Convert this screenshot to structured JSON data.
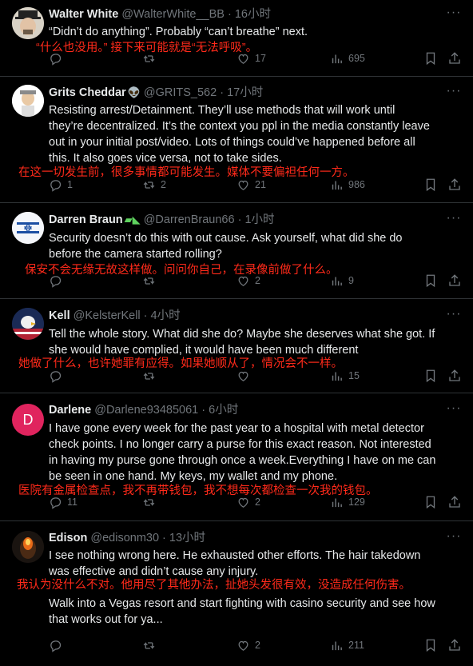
{
  "colors": {
    "background": "#000000",
    "text": "#e7e9ea",
    "muted": "#71767b",
    "translation": "#ff2a1a",
    "divider": "#2f3336"
  },
  "tweets": [
    {
      "name": "Walter White",
      "handle": "@WalterWhite__BB",
      "time": "16小时",
      "lines": [
        "“Didn’t do anything”. Probably “can’t  breathe” next."
      ],
      "translation": "“什么也没用。” 接下来可能就是“无法呼吸”。",
      "replies": "",
      "retweets": "",
      "likes": "17",
      "views": "695"
    },
    {
      "name": "Grits Cheddar",
      "handle": "@GRITS_562",
      "time": "17小时",
      "lines": [
        "Resisting arrest/Detainment. They’ll use methods that will work until",
        "they’re decentralized. It’s the context you ppl in the media constantly leave",
        "out in your initial post/video. Lots of things could’ve happened before all",
        "this. It also goes vice versa, not to take sides."
      ],
      "translation": "在这一切发生前，很多事情都可能发生。媒体不要偏袒任何一方。",
      "replies": "1",
      "retweets": "2",
      "likes": "21",
      "views": "986"
    },
    {
      "name": "Darren Braun",
      "handle": "@DarrenBraun66",
      "time": "1小时",
      "lines": [
        "Security doesn’t do this with out cause. Ask yourself, what did she do",
        "before the camera started rolling?"
      ],
      "translation": "保安不会无缘无故这样做。问问你自己，在录像前做了什么。",
      "replies": "",
      "retweets": "",
      "likes": "2",
      "views": "9"
    },
    {
      "name": "Kell",
      "handle": "@KelsterKell",
      "time": "4小时",
      "lines": [
        "Tell the whole story. What did she do? Maybe she deserves what she got. If",
        "she would have complied, it would have been much different"
      ],
      "translation": "她做了什么，也许她罪有应得。如果她顺从了，情况会不一样。",
      "replies": "",
      "retweets": "",
      "likes": "",
      "views": "15"
    },
    {
      "name": "Darlene",
      "handle": "@Darlene93485061",
      "time": "6小时",
      "avatar_letter": "D",
      "lines": [
        "I have gone every week for the past year to a hospital with metal detector",
        "check points. I no longer carry a purse for this exact reason. Not interested",
        "in having my purse gone through once a week.Everything I have on me can",
        "be seen in one hand. My keys, my wallet and my phone."
      ],
      "translation": "医院有金属检查点，我不再带钱包，我不想每次都检查一次我的钱包。",
      "replies": "11",
      "retweets": "",
      "likes": "2",
      "views": "129"
    },
    {
      "name": "Edison",
      "handle": "@edisonm30",
      "time": "13小时",
      "lines": [
        "I see nothing wrong here. He exhausted other efforts. The hair takedown",
        "was effective and didn’t cause any injury."
      ],
      "translation": "我认为没什么不对。他用尽了其他办法，扯她头发很有效，没造成任何伤害。",
      "lines2": [
        "Walk into a Vegas resort and start fighting with casino security and see how",
        "that works out for ya..."
      ],
      "replies": "",
      "retweets": "",
      "likes": "2",
      "views": "211"
    }
  ]
}
